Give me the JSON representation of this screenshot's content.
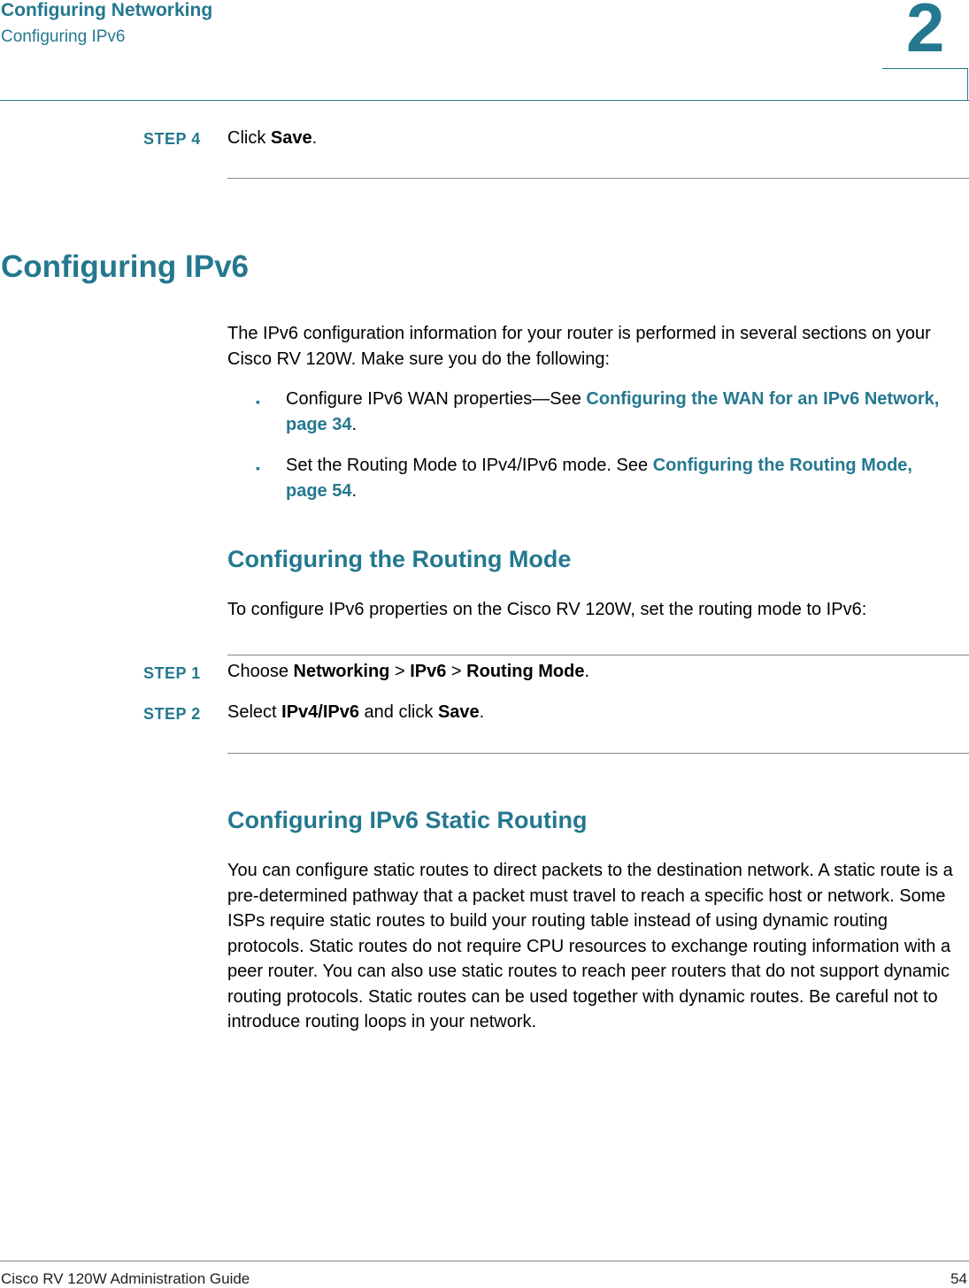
{
  "header": {
    "chapter_title": "Configuring Networking",
    "section_title": "Configuring IPv6",
    "chapter_number": "2"
  },
  "step4": {
    "label": "STEP  4",
    "text_before": "Click ",
    "bold": "Save",
    "text_after": "."
  },
  "section": {
    "heading": "Configuring IPv6",
    "intro": "The IPv6 configuration information for your router is performed in several sections on your Cisco RV 120W. Make sure you do the following:",
    "bullets": [
      {
        "marker": "▪",
        "text": "Configure IPv6 WAN properties—See ",
        "link": "Configuring the WAN for an IPv6 Network, page 34",
        "after": "."
      },
      {
        "marker": "▪",
        "text": "Set the Routing Mode to IPv4/IPv6 mode. See ",
        "link": "Configuring the Routing Mode, page 54",
        "after": "."
      }
    ]
  },
  "routing_mode": {
    "heading": "Configuring the Routing Mode",
    "intro": "To configure IPv6 properties on the Cisco RV 120W, set the routing mode to IPv6:",
    "steps": [
      {
        "label": "STEP  1",
        "parts": [
          "Choose ",
          "Networking",
          " > ",
          "IPv6",
          " > ",
          "Routing Mode",
          "."
        ]
      },
      {
        "label": "STEP  2",
        "parts": [
          "Select ",
          "IPv4/IPv6",
          " and click ",
          "Save",
          "."
        ]
      }
    ]
  },
  "static_routing": {
    "heading": "Configuring IPv6 Static Routing",
    "body": "You can configure static routes to direct packets to the destination network. A static route is a pre-determined pathway that a packet must travel to reach a specific host or network. Some ISPs require static routes to build your routing table instead of using dynamic routing protocols. Static routes do not require CPU resources to exchange routing information with a peer router. You can also use static routes to reach peer routers that do not support dynamic routing protocols. Static routes can be used together with dynamic routes. Be careful not to introduce routing loops in your network."
  },
  "footer": {
    "guide_title": "Cisco RV 120W Administration Guide",
    "page_number": "54"
  }
}
